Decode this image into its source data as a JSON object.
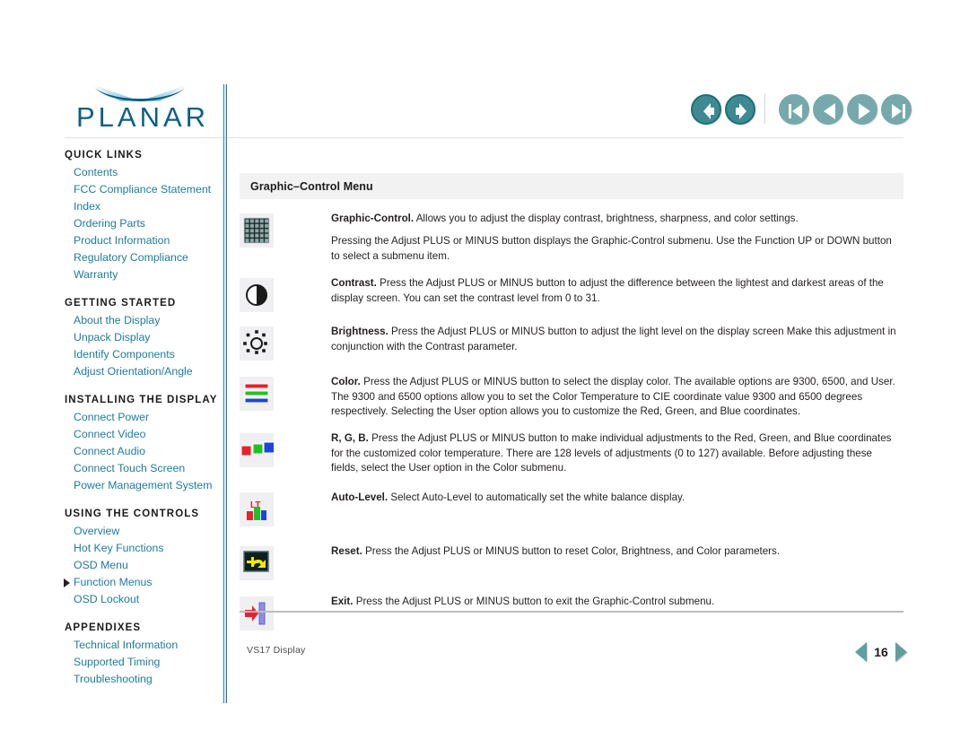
{
  "brand": {
    "name": "PLANAR",
    "logo_color": "#0d5f86"
  },
  "topnav": {
    "history": [
      {
        "name": "back-button",
        "icon": "arrow-left-icon",
        "label": "Back"
      },
      {
        "name": "forward-button",
        "icon": "arrow-right-icon",
        "label": "Forward"
      }
    ],
    "pagination": [
      {
        "name": "first-page-button",
        "icon": "skip-to-start-icon",
        "label": "First Page"
      },
      {
        "name": "previous-page-button",
        "icon": "triangle-left-icon",
        "label": "Previous Page"
      },
      {
        "name": "next-page-button",
        "icon": "triangle-right-icon",
        "label": "Next Page"
      },
      {
        "name": "last-page-button",
        "icon": "skip-to-end-icon",
        "label": "Last Page"
      }
    ],
    "accent_color": "#3e8a91",
    "muted_color": "#76a9ab"
  },
  "sidebar": {
    "link_color": "#1e7b9c",
    "sections": [
      {
        "heading": "QUICK LINKS",
        "links": [
          "Contents",
          "FCC Compliance Statement",
          "Index",
          "Ordering Parts",
          "Product Information",
          "Regulatory Compliance",
          "Warranty"
        ]
      },
      {
        "heading": "GETTING STARTED",
        "links": [
          "About the Display",
          "Unpack Display",
          "Identify Components",
          "Adjust Orientation/Angle"
        ]
      },
      {
        "heading": "INSTALLING THE DISPLAY",
        "links": [
          "Connect Power",
          "Connect Video",
          "Connect Audio",
          "Connect Touch Screen",
          "Power Management System"
        ]
      },
      {
        "heading": "USING THE CONTROLS",
        "links": [
          "Overview",
          "Hot Key Functions",
          "OSD Menu",
          "Function Menus",
          "OSD Lockout"
        ]
      },
      {
        "heading": "APPENDIXES",
        "links": [
          "Technical Information",
          "Supported Timing",
          "Troubleshooting"
        ]
      }
    ],
    "current_link": "Function Menus"
  },
  "main": {
    "section_title": "Graphic–Control Menu",
    "entries": [
      {
        "icon": "grid-pattern-icon",
        "paragraphs": [
          {
            "term": "Graphic-Control.",
            "text": "  Allows you to adjust the display contrast, brightness, sharpness, and color settings."
          },
          {
            "term": "",
            "text": "Pressing the Adjust PLUS or MINUS button displays the Graphic-Control submenu. Use the Function UP or DOWN button to select a submenu item."
          }
        ]
      },
      {
        "icon": "contrast-half-circle-icon",
        "paragraphs": [
          {
            "term": "Contrast.",
            "text": " Press the Adjust PLUS or MINUS button to adjust the difference between the lightest and darkest areas of the display screen. You can set the contrast level from 0 to 31."
          }
        ]
      },
      {
        "icon": "brightness-sun-icon",
        "paragraphs": [
          {
            "term": "Brightness.",
            "text": " Press the Adjust PLUS or MINUS button to adjust the light level on the display screen Make this adjustment in conjunction with the Contrast parameter."
          }
        ]
      },
      {
        "icon": "color-bars-icon",
        "paragraphs": [
          {
            "term": "Color.",
            "text": "  Press the Adjust PLUS or MINUS button to select the display color. The available options are 9300, 6500, and User. The 9300 and 6500 options allow you to set the Color Temperature to CIE coordinate value 9300 and 6500 degrees respectively. Selecting the User option allows you to customize the Red, Green, and Blue coordinates."
          }
        ]
      },
      {
        "icon": "rgb-squares-icon",
        "paragraphs": [
          {
            "term": "R, G, B.",
            "text": " Press the Adjust PLUS or MINUS button to make individual adjustments to the Red, Green, and Blue coordinates for the customized color temperature. There are 128 levels of adjustments (0 to 127) available. Before adjusting these fields, select the User option in the Color submenu."
          }
        ]
      },
      {
        "icon": "auto-level-bars-icon",
        "paragraphs": [
          {
            "term": "Auto-Level.",
            "text": "  Select Auto-Level to automatically set the white balance display."
          }
        ]
      },
      {
        "icon": "reset-arrow-icon",
        "paragraphs": [
          {
            "term": "Reset.",
            "text": "  Press the Adjust PLUS or MINUS button to reset Color, Brightness, and Color parameters."
          }
        ]
      },
      {
        "icon": "exit-door-arrow-icon",
        "paragraphs": [
          {
            "term": "Exit.",
            "text": "  Press the Adjust PLUS or MINUS button to exit the Graphic-Control submenu."
          }
        ]
      }
    ]
  },
  "footer": {
    "document_label": "VS17 Display",
    "page_number": "16",
    "prev_page_label": "Previous page",
    "next_page_label": "Next page"
  }
}
